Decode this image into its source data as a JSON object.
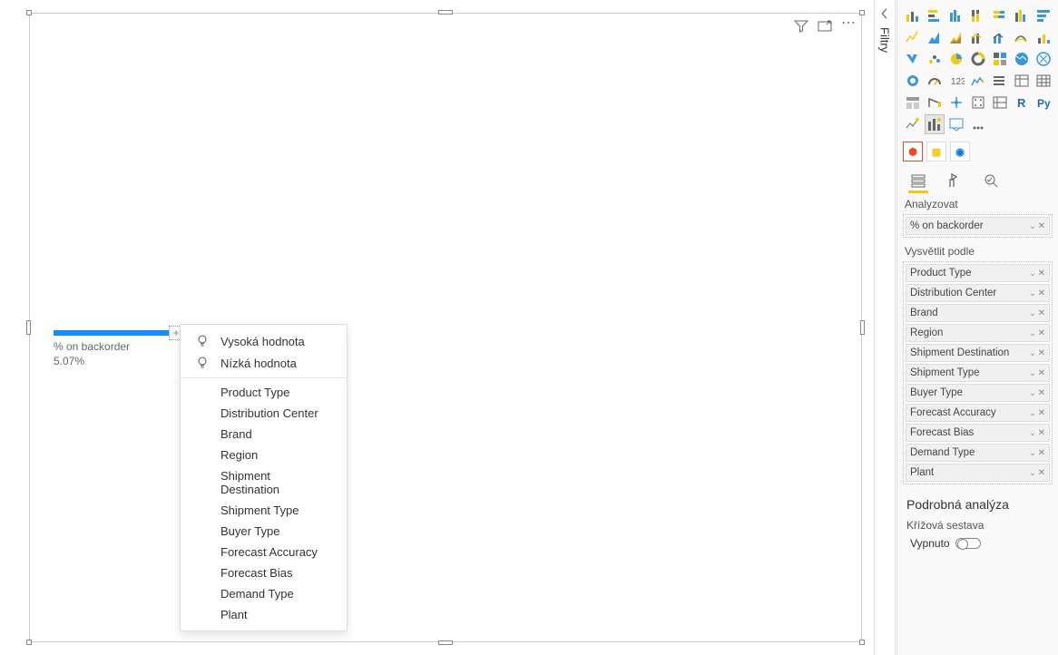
{
  "visual": {
    "metric_label": "% on backorder",
    "metric_value": "5.07%"
  },
  "context_menu": {
    "high": "Vysoká hodnota",
    "low": "Nízká hodnota",
    "items": [
      "Product Type",
      "Distribution Center",
      "Brand",
      "Region",
      "Shipment Destination",
      "Shipment Type",
      "Buyer Type",
      "Forecast Accuracy",
      "Forecast Bias",
      "Demand Type",
      "Plant"
    ]
  },
  "filters_pane": {
    "label": "Filtry"
  },
  "viz_pane": {
    "analyze_label": "Analyzovat",
    "analyze_field": "% on backorder",
    "explain_by_label": "Vysvětlit podle",
    "explain_fields": [
      "Product Type",
      "Distribution Center",
      "Brand",
      "Region",
      "Shipment Destination",
      "Shipment Type",
      "Buyer Type",
      "Forecast Accuracy",
      "Forecast Bias",
      "Demand Type",
      "Plant"
    ],
    "drillthrough_header": "Podrobná analýza",
    "cross_report": "Křížová sestava",
    "toggle_off": "Vypnuto"
  }
}
